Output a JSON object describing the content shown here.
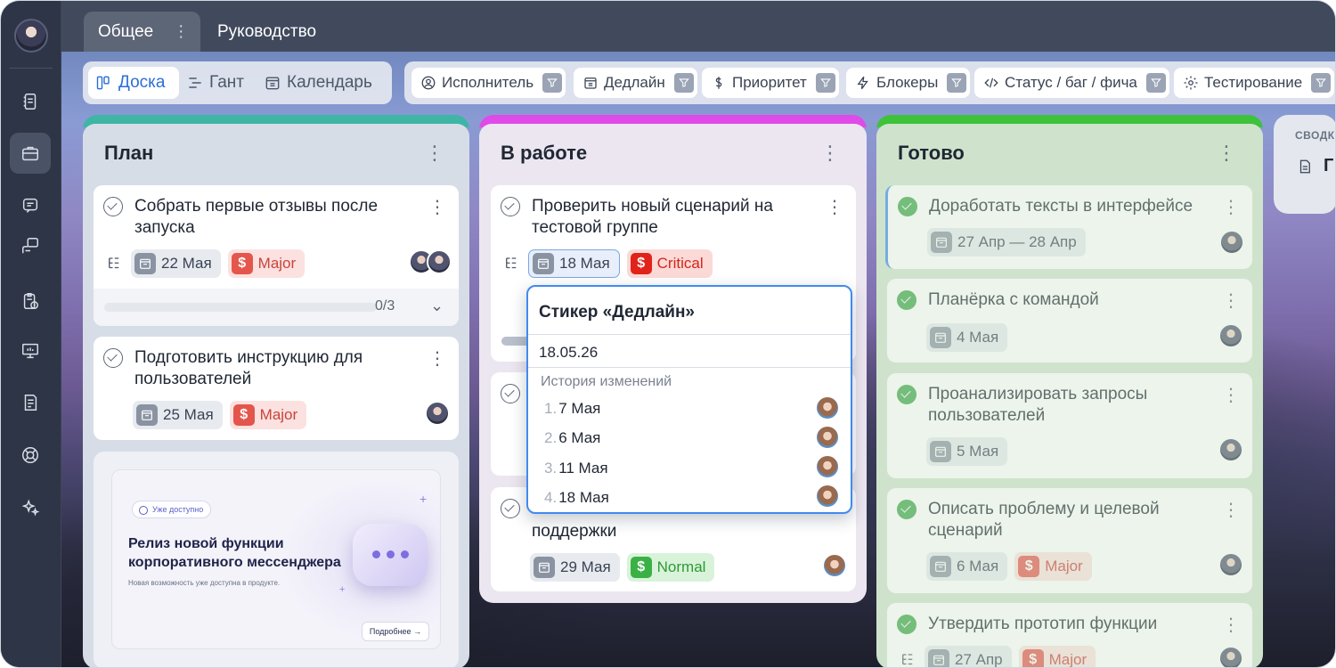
{
  "tabs": [
    {
      "label": "Общее"
    },
    {
      "label": "Руководство"
    }
  ],
  "views": [
    {
      "label": "Доска",
      "icon": "board-icon",
      "active": true
    },
    {
      "label": "Гант",
      "icon": "gantt-icon",
      "active": false
    },
    {
      "label": "Календарь",
      "icon": "calendar-icon",
      "active": false
    }
  ],
  "filters": [
    {
      "label": "Исполнитель",
      "icon": "user-circle-icon"
    },
    {
      "label": "Дедлайн",
      "icon": "calendar-icon"
    },
    {
      "label": "Приоритет",
      "icon": "dollar-icon"
    },
    {
      "label": "Блокеры",
      "icon": "lightning-icon"
    },
    {
      "label": "Статус / баг / фича",
      "icon": "code-icon"
    },
    {
      "label": "Тестирование",
      "icon": "settings-icon"
    }
  ],
  "columns": {
    "plan": {
      "title": "План",
      "color": "#3fb5a6",
      "cards": [
        {
          "title": "Собрать первые отзывы после запуска",
          "date": "22 Мая",
          "priority": "Major",
          "progress": "0/3"
        },
        {
          "title": "Подготовить инструкцию для пользователей",
          "date": "25 Мая",
          "priority": "Major"
        }
      ],
      "promo": {
        "badge": "Уже доступно",
        "title": "Релиз новой функции корпоративного мессенджера",
        "subtitle": "Новая возможность уже доступна в продукте.",
        "button": "Подробнее"
      }
    },
    "work": {
      "title": "В работе",
      "color": "#e04ae8",
      "cards": [
        {
          "title": "Проверить новый сценарий на тестовой группе",
          "date": "18 Мая",
          "priority": "Critical"
        },
        {
          "title": "поддержки",
          "date": "29 Мая",
          "priority": "Normal"
        }
      ]
    },
    "done": {
      "title": "Готово",
      "color": "#3ec23a",
      "cards": [
        {
          "title": "Доработать тексты в интерфейсе",
          "date": "27 Апр — 28 Апр"
        },
        {
          "title": "Планёрка с командой",
          "date": "4 Мая"
        },
        {
          "title": "Проанализировать запросы пользователей",
          "date": "5 Мая"
        },
        {
          "title": "Описать проблему и целевой сценарий",
          "date": "6 Мая",
          "priority": "Major"
        },
        {
          "title": "Утвердить прототип функции",
          "date": "27 Апр",
          "priority": "Major"
        }
      ]
    },
    "summary": {
      "label": "СВОДК",
      "item": "Г"
    }
  },
  "popover": {
    "title": "Стикер «Дедлайн»",
    "value": "18.05.26",
    "history_label": "История изменений",
    "history": [
      {
        "n": "1.",
        "date": "7 Мая"
      },
      {
        "n": "2.",
        "date": "6 Мая"
      },
      {
        "n": "3.",
        "date": "11 Мая"
      },
      {
        "n": "4.",
        "date": "18 Мая"
      }
    ]
  },
  "colors": {
    "accent": "#2b6fd6",
    "critical": "#e2231a",
    "major": "#e4564c",
    "normal": "#3ab144"
  }
}
